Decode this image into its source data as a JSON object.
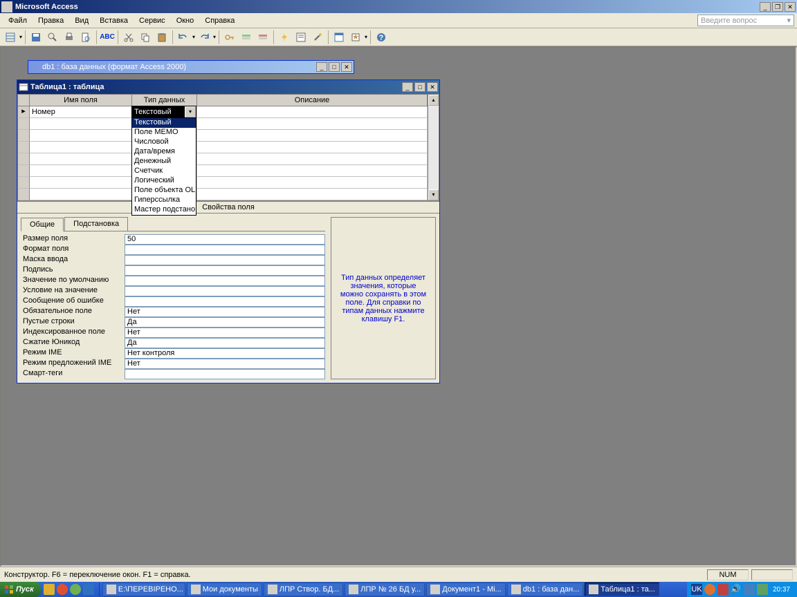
{
  "app": {
    "title": "Microsoft Access"
  },
  "menu": {
    "items": [
      "Файл",
      "Правка",
      "Вид",
      "Вставка",
      "Сервис",
      "Окно",
      "Справка"
    ],
    "ask_placeholder": "Введите вопрос"
  },
  "db_window": {
    "title": "db1 : база данных (формат Access 2000)"
  },
  "table_window": {
    "title": "Таблица1 : таблица",
    "columns": {
      "name": "Имя поля",
      "type": "Тип данных",
      "desc": "Описание"
    },
    "row1_name": "Номер",
    "row1_type": "Текстовый",
    "props_header": "Свойства поля"
  },
  "datatypes": {
    "selected": "Текстовый",
    "options": [
      "Текстовый",
      "Поле МЕМО",
      "Числовой",
      "Дата/время",
      "Денежный",
      "Счетчик",
      "Логический",
      "Поле объекта OLE",
      "Гиперссылка",
      "Мастер подстано"
    ]
  },
  "tabs": {
    "general": "Общие",
    "lookup": "Подстановка"
  },
  "properties": [
    {
      "label": "Размер поля",
      "value": "50"
    },
    {
      "label": "Формат поля",
      "value": ""
    },
    {
      "label": "Маска ввода",
      "value": ""
    },
    {
      "label": "Подпись",
      "value": ""
    },
    {
      "label": "Значение по умолчанию",
      "value": ""
    },
    {
      "label": "Условие на значение",
      "value": ""
    },
    {
      "label": "Сообщение об ошибке",
      "value": ""
    },
    {
      "label": "Обязательное поле",
      "value": "Нет"
    },
    {
      "label": "Пустые строки",
      "value": "Да"
    },
    {
      "label": "Индексированное поле",
      "value": "Нет"
    },
    {
      "label": "Сжатие Юникод",
      "value": "Да"
    },
    {
      "label": "Режим IME",
      "value": "Нет контроля"
    },
    {
      "label": "Режим предложений IME",
      "value": "Нет"
    },
    {
      "label": "Смарт-теги",
      "value": ""
    }
  ],
  "help_text": "Тип данных определяет значения, которые можно сохранять в этом поле. Для справки по типам данных нажмите клавишу F1.",
  "statusbar": {
    "text": "Конструктор.  F6 = переключение окон.  F1 = справка.",
    "num": "NUM"
  },
  "taskbar": {
    "start": "Пуск",
    "items": [
      "E:\\ПЕРЕВІРЕНО...",
      "Мои документы",
      "ЛПР Створ. БД...",
      "ЛПР № 26 БД у...",
      "Документ1 - Mi...",
      "db1 : база дан...",
      "Таблица1 : та..."
    ],
    "lang": "UK",
    "clock": "20:37"
  }
}
